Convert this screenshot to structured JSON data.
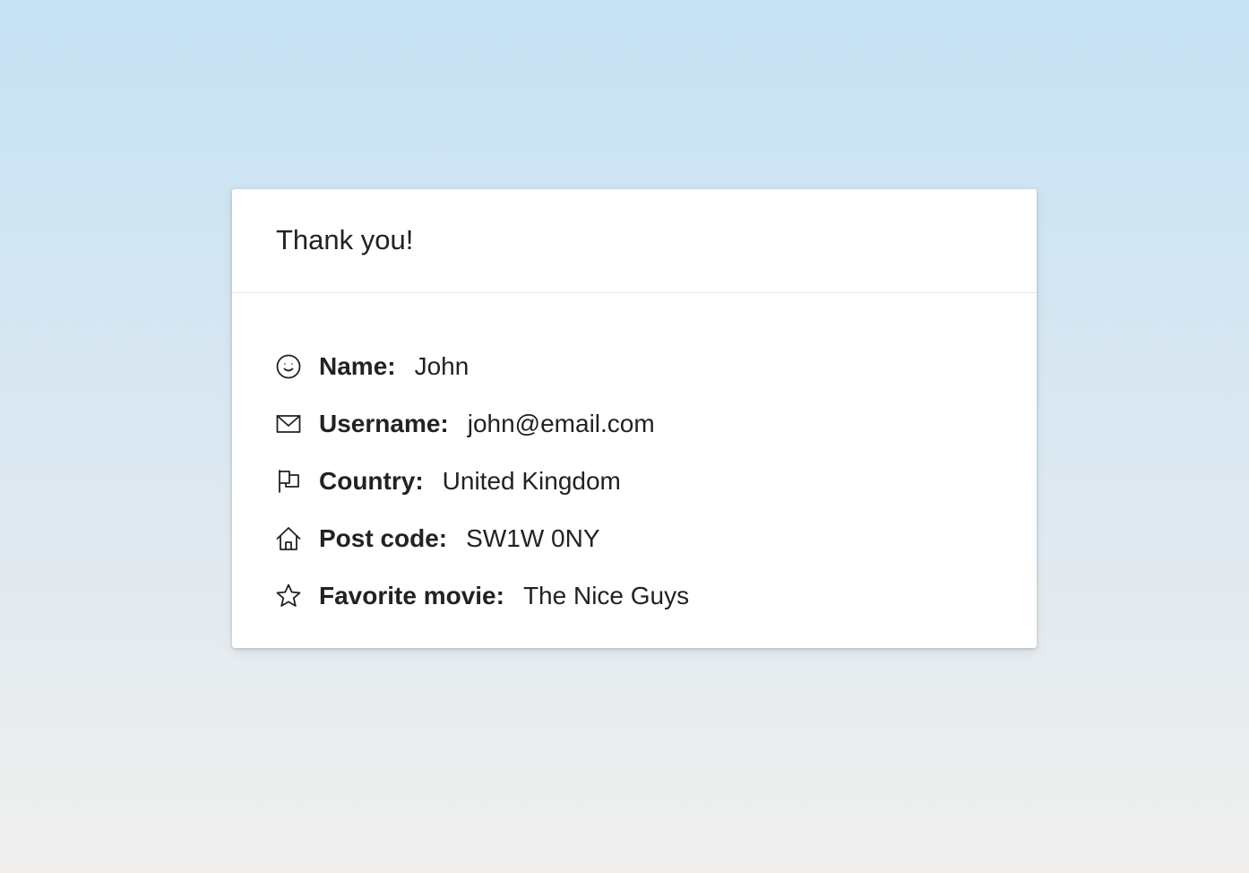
{
  "card": {
    "title": "Thank you!",
    "fields": [
      {
        "icon": "smiley-icon",
        "label": "Name:",
        "value": "John"
      },
      {
        "icon": "envelope-icon",
        "label": "Username:",
        "value": "john@email.com"
      },
      {
        "icon": "flag-icon",
        "label": "Country:",
        "value": "United Kingdom"
      },
      {
        "icon": "home-icon",
        "label": "Post code:",
        "value": "SW1W 0NY"
      },
      {
        "icon": "star-icon",
        "label": "Favorite movie:",
        "value": "The Nice Guys"
      }
    ]
  }
}
